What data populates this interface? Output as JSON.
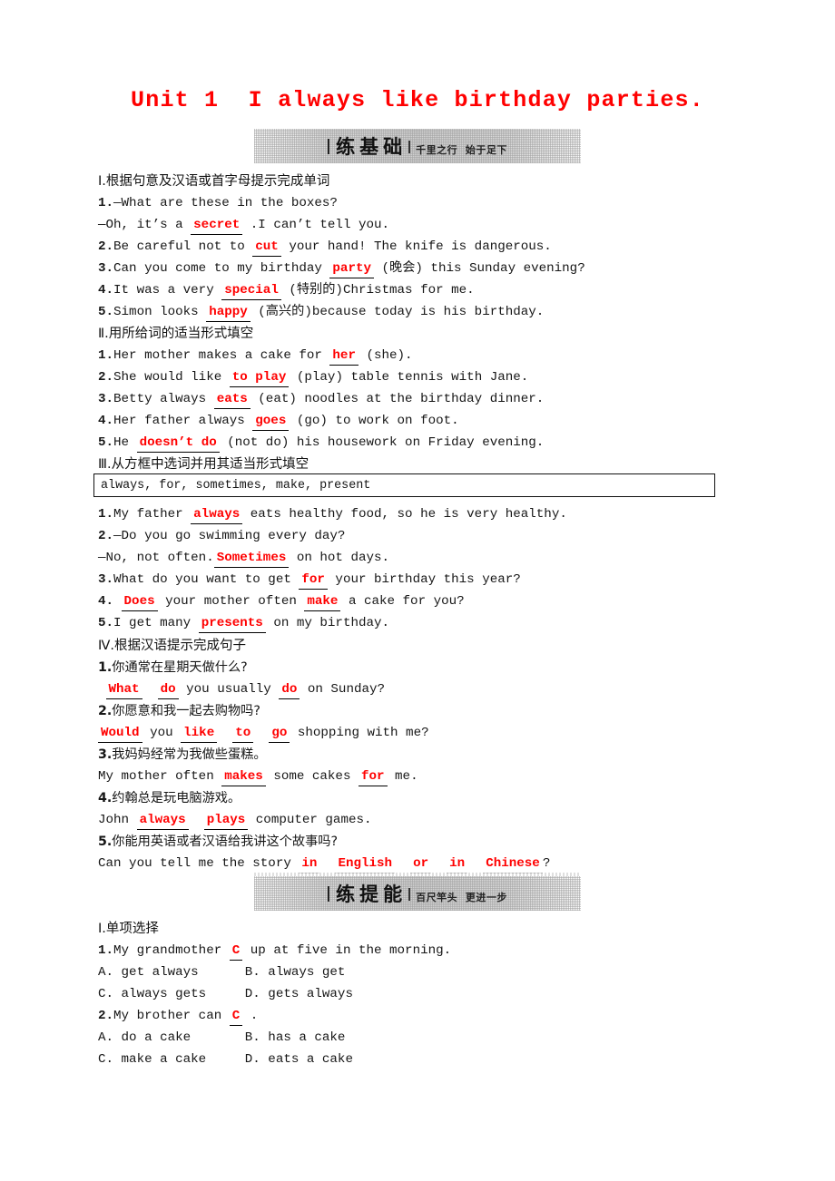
{
  "title": "Unit 1  I always like birthday parties.",
  "banners": [
    {
      "main": "练基础",
      "sub": "千里之行  始于足下"
    },
    {
      "main": "练提能",
      "sub": "百尺竿头  更进一步"
    }
  ],
  "word_bank": "always, for, sometimes, make, present",
  "sections": [
    {
      "heading": "Ⅰ.根据句意及汉语或首字母提示完成单词",
      "items": [
        {
          "num": "1.",
          "parts": [
            {
              "t": "—What are these in the boxes?"
            }
          ]
        },
        {
          "num": "",
          "parts": [
            {
              "t": "—Oh, it’s a "
            },
            {
              "a": "secret"
            },
            {
              "t": " .I can’t tell you."
            }
          ]
        },
        {
          "num": "2.",
          "parts": [
            {
              "t": "Be careful not to "
            },
            {
              "a": "cut"
            },
            {
              "t": " your hand! The knife is dangerous."
            }
          ]
        },
        {
          "num": "3.",
          "parts": [
            {
              "t": "Can you come to my birthday "
            },
            {
              "a": "party"
            },
            {
              "t": " (晚会) this Sunday evening?"
            }
          ]
        },
        {
          "num": "4.",
          "parts": [
            {
              "t": "It was a very "
            },
            {
              "a": "special"
            },
            {
              "t": " (特别的)Christmas for me."
            }
          ]
        },
        {
          "num": "5.",
          "parts": [
            {
              "t": "Simon looks "
            },
            {
              "a": "happy"
            },
            {
              "t": " (高兴的)because today is his birthday."
            }
          ]
        }
      ]
    },
    {
      "heading": "Ⅱ.用所给词的适当形式填空",
      "items": [
        {
          "num": "1.",
          "parts": [
            {
              "t": "Her mother makes a cake for "
            },
            {
              "a": "her"
            },
            {
              "t": " (she)."
            }
          ]
        },
        {
          "num": "2.",
          "parts": [
            {
              "t": "She would like "
            },
            {
              "a": "to play"
            },
            {
              "t": " (play) table tennis with Jane."
            }
          ]
        },
        {
          "num": "3.",
          "parts": [
            {
              "t": "Betty always "
            },
            {
              "a": "eats"
            },
            {
              "t": " (eat) noodles at the birthday dinner."
            }
          ]
        },
        {
          "num": "4.",
          "parts": [
            {
              "t": "Her father always "
            },
            {
              "a": "goes"
            },
            {
              "t": " (go) to work on foot."
            }
          ]
        },
        {
          "num": "5.",
          "parts": [
            {
              "t": "He "
            },
            {
              "a": "doesn’t do"
            },
            {
              "t": " (not do) his housework on Friday evening."
            }
          ]
        }
      ]
    },
    {
      "heading": "Ⅲ.从方框中选词并用其适当形式填空",
      "items": [
        {
          "num": "1.",
          "parts": [
            {
              "t": "My father "
            },
            {
              "a": "always"
            },
            {
              "t": " eats healthy food, so he is very healthy."
            }
          ]
        },
        {
          "num": "2.",
          "parts": [
            {
              "t": "—Do you go swimming every day?"
            }
          ]
        },
        {
          "num": "",
          "parts": [
            {
              "t": "—No, not often."
            },
            {
              "a": "Sometimes"
            },
            {
              "t": " on hot days."
            }
          ]
        },
        {
          "num": "3.",
          "parts": [
            {
              "t": "What do you want to get "
            },
            {
              "a": "for"
            },
            {
              "t": " your birthday this year?"
            }
          ]
        },
        {
          "num": "4.",
          "parts": [
            {
              "t": " "
            },
            {
              "a": "Does"
            },
            {
              "t": " your mother often "
            },
            {
              "a": "make"
            },
            {
              "t": " a cake for you?"
            }
          ]
        },
        {
          "num": "5.",
          "parts": [
            {
              "t": "I get many "
            },
            {
              "a": "presents"
            },
            {
              "t": " on my birthday."
            }
          ]
        }
      ]
    },
    {
      "heading": "Ⅳ.根据汉语提示完成句子",
      "items": [
        {
          "num": "1.",
          "parts": [
            {
              "t": "你通常在星期天做什么?"
            }
          ],
          "cjk": true
        },
        {
          "num": "",
          "parts": [
            {
              "t": " "
            },
            {
              "a": "What"
            },
            {
              "t": "  "
            },
            {
              "a": "do"
            },
            {
              "t": " you usually "
            },
            {
              "a": "do"
            },
            {
              "t": " on Sunday?"
            }
          ]
        },
        {
          "num": "2.",
          "parts": [
            {
              "t": "你愿意和我一起去购物吗?"
            }
          ],
          "cjk": true
        },
        {
          "num": "",
          "parts": [
            {
              "a": "Would"
            },
            {
              "t": " you "
            },
            {
              "a": "like"
            },
            {
              "t": "  "
            },
            {
              "a": "to"
            },
            {
              "t": "  "
            },
            {
              "a": "go"
            },
            {
              "t": " shopping with me?"
            }
          ]
        },
        {
          "num": "3.",
          "parts": [
            {
              "t": "我妈妈经常为我做些蛋糕。"
            }
          ],
          "cjk": true
        },
        {
          "num": "",
          "parts": [
            {
              "t": "My mother often "
            },
            {
              "a": "makes"
            },
            {
              "t": " some cakes "
            },
            {
              "a": "for"
            },
            {
              "t": " me."
            }
          ]
        },
        {
          "num": "4.",
          "parts": [
            {
              "t": "约翰总是玩电脑游戏。"
            }
          ],
          "cjk": true
        },
        {
          "num": "",
          "parts": [
            {
              "t": "John "
            },
            {
              "a": "always"
            },
            {
              "t": "  "
            },
            {
              "a": "plays"
            },
            {
              "t": " computer games."
            }
          ]
        },
        {
          "num": "5.",
          "parts": [
            {
              "t": "你能用英语或者汉语给我讲这个故事吗?"
            }
          ],
          "cjk": true
        },
        {
          "num": "",
          "parts": [
            {
              "t": "Can you tell me the story "
            },
            {
              "a": "in"
            },
            {
              "t": "  "
            },
            {
              "a": "English"
            },
            {
              "t": "  "
            },
            {
              "a": "or"
            },
            {
              "t": "  "
            },
            {
              "a": "in"
            },
            {
              "t": "  "
            },
            {
              "a": "Chinese"
            },
            {
              "t": "?"
            }
          ]
        }
      ]
    },
    {
      "heading": "Ⅰ.单项选择",
      "items": [
        {
          "num": "1.",
          "parts": [
            {
              "t": "My grandmother "
            },
            {
              "a": "C"
            },
            {
              "t": " up at five in the morning."
            }
          ]
        },
        {
          "num": "",
          "parts": [
            {
              "t": ""
            }
          ]
        },
        {
          "num": "",
          "parts": [
            {
              "t": "A. get always      B. always get"
            }
          ]
        },
        {
          "num": "",
          "parts": [
            {
              "t": "C. always gets     D. gets always"
            }
          ]
        },
        {
          "num": "2.",
          "parts": [
            {
              "t": "My brother can "
            },
            {
              "a": "C"
            },
            {
              "t": " ."
            }
          ]
        },
        {
          "num": "",
          "parts": [
            {
              "t": "A. do a cake       B. has a cake"
            }
          ]
        },
        {
          "num": "",
          "parts": [
            {
              "t": "C. make a cake     D. eats a cake"
            }
          ]
        }
      ]
    }
  ],
  "colors": {
    "answer_red": "#ff0000",
    "title_red": "#ff0000",
    "text_black": "#161616",
    "banner_gray": "#d2d2d2"
  }
}
